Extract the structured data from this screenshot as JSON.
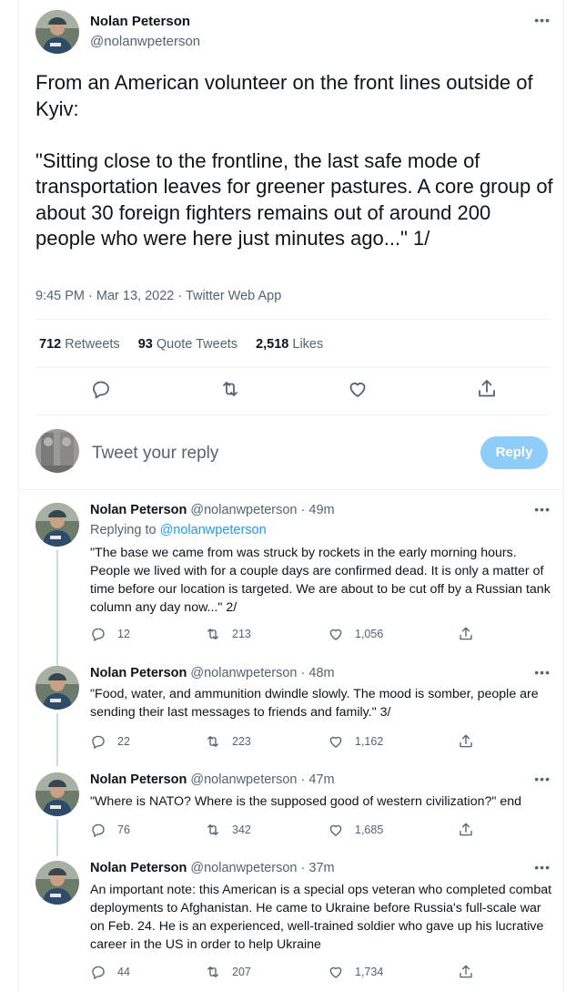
{
  "main_tweet": {
    "author_name": "Nolan Peterson",
    "author_handle": "@nolanwpeterson",
    "more_icon": "more-icon",
    "text": "From an American volunteer on the front lines outside of Kyiv:\n\n\"Sitting close to the frontline, the last safe mode of transportation leaves for greener pastures. A core group of about 30 foreign fighters remains out of around 200 people who were here just minutes ago...\" 1/",
    "timestamp": "9:45 PM · Mar 13, 2022 · Twitter Web App",
    "retweets_count": "712",
    "retweets_label": "Retweets",
    "quotes_count": "93",
    "quotes_label": "Quote Tweets",
    "likes_count": "2,518",
    "likes_label": "Likes",
    "actions": [
      "reply-icon",
      "retweet-icon",
      "like-icon",
      "share-icon"
    ]
  },
  "composer": {
    "placeholder": "Tweet your reply",
    "reply_button": "Reply"
  },
  "replies": [
    {
      "name": "Nolan Peterson",
      "handle_time": "@nolanwpeterson · 49m",
      "replying_prefix": "Replying to ",
      "replying_to": "@nolanwpeterson",
      "text": "\"The base we came from was struck by rockets in the early morning hours. People we lived with for a couple days are confirmed dead. It is only a matter of time before our location is targeted. We are about to be cut off by a Russian tank column any day now...\" 2/",
      "replies": "12",
      "retweets": "213",
      "likes": "1,056"
    },
    {
      "name": "Nolan Peterson",
      "handle_time": "@nolanwpeterson · 48m",
      "text": "\"Food, water, and ammunition dwindle slowly. The mood is somber, people are sending their last messages to friends and family.\" 3/",
      "replies": "22",
      "retweets": "223",
      "likes": "1,162"
    },
    {
      "name": "Nolan Peterson",
      "handle_time": "@nolanwpeterson · 47m",
      "text": "\"Where is NATO? Where is the supposed good of western civilization?\" end",
      "replies": "76",
      "retweets": "342",
      "likes": "1,685"
    },
    {
      "name": "Nolan Peterson",
      "handle_time": "@nolanwpeterson · 37m",
      "text": "An important note: this American is a special ops veteran who completed combat deployments to Afghanistan. He came to Ukraine before Russia's full-scale war on Feb. 24. He is an experienced, well-trained soldier who gave up his lucrative career in the US in order to help Ukraine",
      "replies": "44",
      "retweets": "207",
      "likes": "1,734"
    }
  ],
  "colors": {
    "text": "#0f1419",
    "secondary": "#536471",
    "accent": "#1d9bf0",
    "reply_button_disabled": "#8ecdf8",
    "divider": "#eff3f4"
  }
}
